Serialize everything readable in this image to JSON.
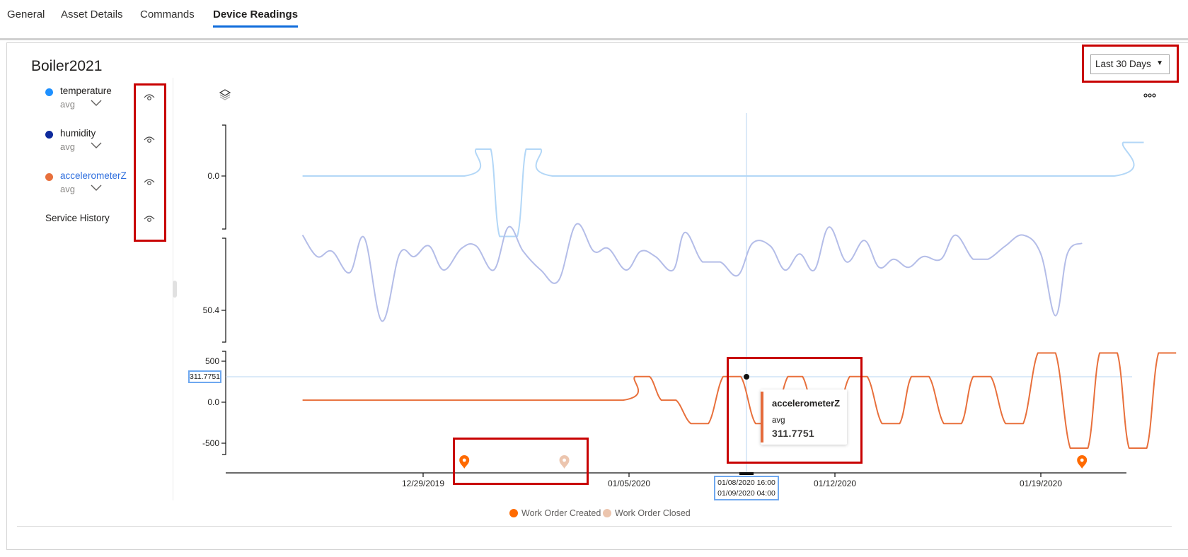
{
  "tabs": [
    {
      "label": "General",
      "active": false
    },
    {
      "label": "Asset Details",
      "active": false
    },
    {
      "label": "Commands",
      "active": false
    },
    {
      "label": "Device Readings",
      "active": true
    }
  ],
  "asset_title": "Boiler2021",
  "time_range": {
    "selected": "Last 30 Days",
    "caret": "▼"
  },
  "series_legend": [
    {
      "name": "temperature",
      "aggregate": "avg",
      "color": "#1e90ff",
      "highlighted": false
    },
    {
      "name": "humidity",
      "aggregate": "avg",
      "color": "#0e2a9c",
      "highlighted": false
    },
    {
      "name": "accelerometerZ",
      "aggregate": "avg",
      "color": "#e8703c",
      "highlighted": true
    }
  ],
  "service_history_label": "Service History",
  "events_legend": [
    {
      "label": "Work Order Created",
      "color": "#ff6a00"
    },
    {
      "label": "Work Order Closed",
      "color": "#ecc5ae"
    }
  ],
  "hover": {
    "value_label": "311.7751",
    "time_label_start": "01/08/2020 16:00",
    "time_label_end": "01/09/2020 04:00",
    "tooltip_series": "accelerometerZ",
    "tooltip_aggregate": "avg",
    "tooltip_value": "311.7751"
  },
  "colors": {
    "accent": "#0f6cdb",
    "highlight_box": "#c80000",
    "crosshair": "#b7d5f0"
  },
  "chart_data": {
    "type": "line",
    "title": "Boiler2021",
    "x_axis": {
      "tick_labels": [
        "12/29/2019",
        "01/05/2020",
        "01/12/2020",
        "01/19/2020"
      ],
      "range_days_from_12_29_2019": [
        -5.5,
        24.9
      ]
    },
    "x_days_from_12_29_2019": [
      -4.1,
      1.4,
      1.7,
      2.0,
      2.6,
      2.9,
      3.2,
      3.9,
      6.8,
      7.1,
      7.5,
      8.1,
      9.0,
      9.3,
      9.7,
      10.1,
      10.4,
      11.0,
      11.6,
      11.9,
      12.6,
      13.2,
      13.5,
      14.1,
      14.7,
      15.0,
      15.6,
      16.0,
      16.3,
      16.9,
      17.5,
      17.8,
      18.3,
      18.6,
      19.0,
      19.6,
      20.2,
      20.5,
      21.1,
      21.7,
      22.1,
      22.6,
      23.1,
      23.5,
      23.8,
      24.0,
      24.5
    ],
    "series": [
      {
        "name": "temperature",
        "aggregate": "avg",
        "color": "#b3d7f7",
        "y_tick_labels": [
          "0.0"
        ],
        "points": [
          [
            -4.1,
            0.0
          ],
          [
            1.4,
            0.0
          ],
          [
            1.8,
            0.4
          ],
          [
            2.3,
            0.4
          ],
          [
            2.6,
            -0.9
          ],
          [
            3.2,
            -0.9
          ],
          [
            3.5,
            0.4
          ],
          [
            4.0,
            0.4
          ],
          [
            4.4,
            0.0
          ],
          [
            10.0,
            0.0
          ],
          [
            16.0,
            0.0
          ],
          [
            23.5,
            0.0
          ],
          [
            23.8,
            0.5
          ],
          [
            24.5,
            0.5
          ]
        ]
      },
      {
        "name": "humidity",
        "aggregate": "avg",
        "color": "#b4bde8",
        "y_tick_labels": [
          "50.4"
        ],
        "points": [
          [
            -4.1,
            53.2
          ],
          [
            -3.6,
            52.4
          ],
          [
            -3.1,
            52.6
          ],
          [
            -2.5,
            51.8
          ],
          [
            -2.0,
            53.1
          ],
          [
            -1.4,
            50.0
          ],
          [
            -0.8,
            52.5
          ],
          [
            -0.3,
            52.4
          ],
          [
            0.2,
            52.8
          ],
          [
            0.7,
            51.9
          ],
          [
            1.3,
            52.7
          ],
          [
            1.8,
            52.8
          ],
          [
            2.4,
            51.9
          ],
          [
            2.9,
            53.5
          ],
          [
            3.4,
            52.6
          ],
          [
            4.0,
            51.9
          ],
          [
            4.6,
            51.5
          ],
          [
            5.2,
            53.6
          ],
          [
            5.8,
            52.6
          ],
          [
            6.3,
            52.7
          ],
          [
            6.9,
            51.9
          ],
          [
            7.4,
            52.6
          ],
          [
            7.9,
            52.4
          ],
          [
            8.5,
            51.9
          ],
          [
            8.9,
            53.3
          ],
          [
            9.5,
            52.2
          ],
          [
            10.1,
            52.2
          ],
          [
            10.7,
            51.7
          ],
          [
            11.2,
            52.9
          ],
          [
            11.8,
            52.8
          ],
          [
            12.3,
            51.9
          ],
          [
            12.8,
            52.5
          ],
          [
            13.3,
            51.9
          ],
          [
            13.8,
            53.5
          ],
          [
            14.4,
            52.2
          ],
          [
            15.0,
            53.0
          ],
          [
            15.5,
            52.0
          ],
          [
            16.0,
            52.3
          ],
          [
            16.5,
            52.0
          ],
          [
            17.0,
            52.4
          ],
          [
            17.6,
            52.3
          ],
          [
            18.1,
            53.2
          ],
          [
            18.7,
            52.3
          ],
          [
            19.2,
            52.3
          ],
          [
            19.8,
            52.8
          ],
          [
            20.4,
            53.2
          ],
          [
            21.0,
            52.5
          ],
          [
            21.5,
            50.2
          ],
          [
            21.9,
            52.5
          ],
          [
            22.4,
            52.9
          ]
        ]
      },
      {
        "name": "accelerometerZ",
        "aggregate": "avg",
        "color": "#e8703c",
        "y_tick_labels": [
          "500",
          "0.0",
          "-500"
        ],
        "ylim": [
          -620,
          620
        ],
        "points": [
          [
            -4.1,
            25
          ],
          [
            1.8,
            25
          ],
          [
            6.8,
            25
          ],
          [
            7.2,
            312
          ],
          [
            7.7,
            312
          ],
          [
            8.1,
            25
          ],
          [
            8.6,
            25
          ],
          [
            9.1,
            -260
          ],
          [
            9.7,
            -260
          ],
          [
            10.2,
            312
          ],
          [
            10.8,
            312
          ],
          [
            11.3,
            -260
          ],
          [
            11.9,
            -260
          ],
          [
            12.4,
            312
          ],
          [
            12.9,
            312
          ],
          [
            13.4,
            -260
          ],
          [
            14.0,
            -260
          ],
          [
            14.5,
            312
          ],
          [
            15.1,
            312
          ],
          [
            15.6,
            -260
          ],
          [
            16.2,
            -260
          ],
          [
            16.6,
            312
          ],
          [
            17.2,
            312
          ],
          [
            17.7,
            -260
          ],
          [
            18.3,
            -260
          ],
          [
            18.7,
            312
          ],
          [
            19.3,
            312
          ],
          [
            19.8,
            -260
          ],
          [
            20.4,
            -260
          ],
          [
            20.9,
            600
          ],
          [
            21.5,
            600
          ],
          [
            22.0,
            -560
          ],
          [
            22.6,
            -560
          ],
          [
            23.0,
            600
          ],
          [
            23.6,
            600
          ],
          [
            24.0,
            -560
          ],
          [
            24.6,
            -560
          ],
          [
            25.0,
            600
          ],
          [
            25.6,
            600
          ]
        ]
      }
    ],
    "events": [
      {
        "type": "Work Order Created",
        "x_day": 1.4
      },
      {
        "type": "Work Order Closed",
        "x_day": 4.8
      },
      {
        "type": "Work Order Created",
        "x_day": 22.4
      }
    ],
    "crosshair": {
      "time_start": "01/08/2020 16:00",
      "time_end": "01/09/2020 04:00",
      "value": 311.7751,
      "series": "accelerometerZ"
    },
    "legend_position": "bottom",
    "grid": false
  }
}
